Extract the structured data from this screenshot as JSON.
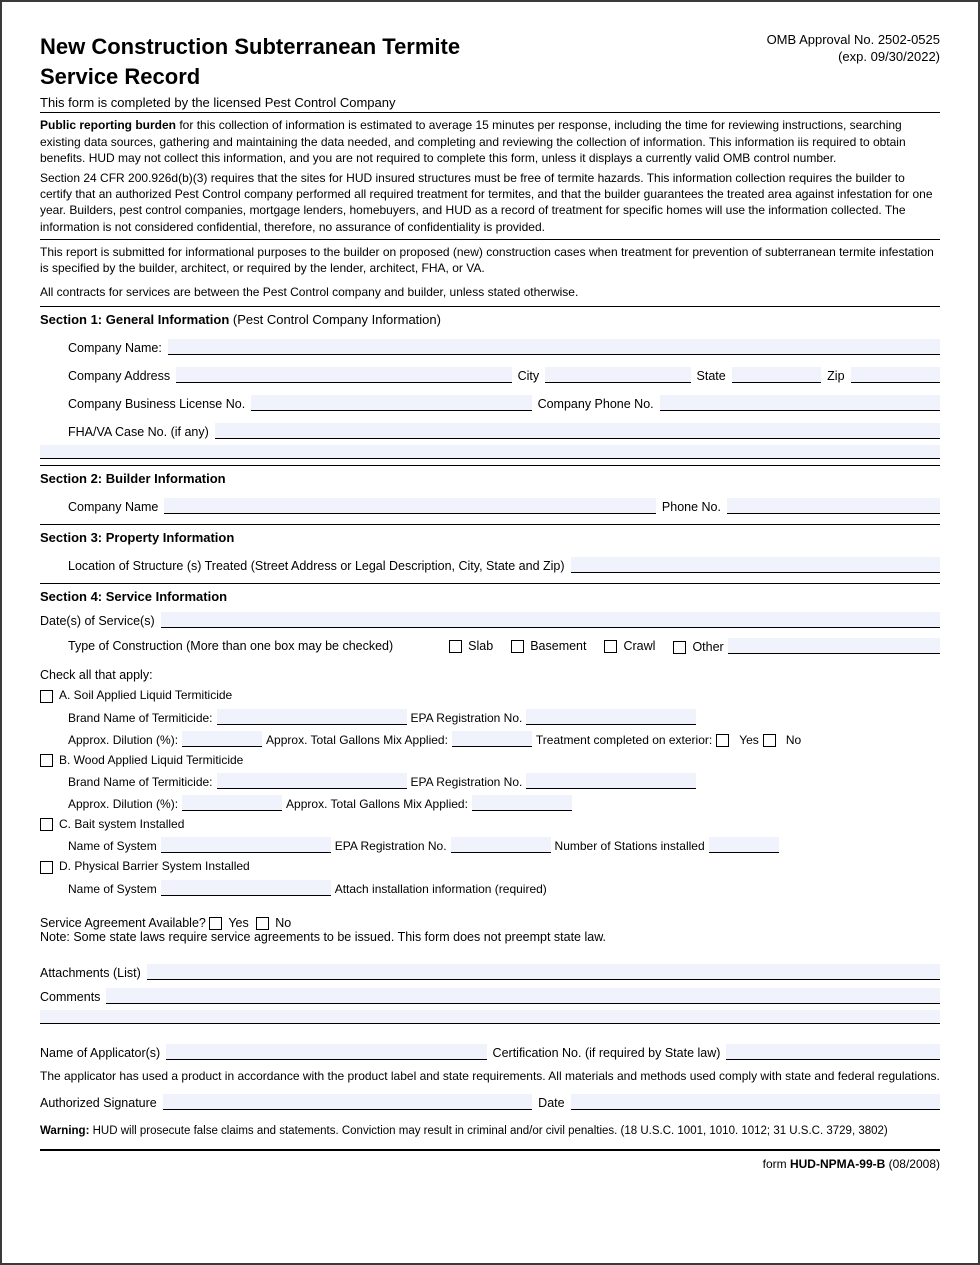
{
  "header": {
    "title_line1": "New Construction Subterranean Termite",
    "title_line2": "Service Record",
    "omb_line1": "OMB Approval No. 2502-0525",
    "omb_line2": "(exp. 09/30/2022)",
    "subtitle": "This form is completed by the licensed Pest Control Company"
  },
  "intro": {
    "burden_label": "Public reporting burden",
    "burden_text": " for this collection of information is estimated to average 15 minutes per response, including the time for reviewing instructions, searching existing data sources, gathering and maintaining the data needed, and completing and reviewing the collection of information. This information iis required to obtain benefits. HUD may not collect this information, and you are not required to complete this form, unless it displays a currently valid OMB control number.",
    "cfr": "Section 24 CFR 200.926d(b)(3) requires that the sites for HUD insured structures must be free of termite hazards. This information collection requires the builder to certify that an authorized Pest Control company performed all required treatment for termites, and that the builder guarantees the treated area against infestation for one year. Builders, pest control companies, mortgage lenders, homebuyers, and HUD as a record of treatment for specific homes will use the information collected. The information is not considered confidential, therefore, no assurance of confidentiality is provided.",
    "purpose": "This report is submitted for informational purposes to the builder on proposed (new) construction cases when treatment for prevention of subterranean termite infestation is specified by the builder, architect, or required by the lender, architect, FHA, or VA.",
    "contracts": "All contracts for services are between the Pest Control company and builder, unless stated otherwise."
  },
  "s1": {
    "head": "Section 1: General Information",
    "head_paren": " (Pest Control Company Information)",
    "company_name": "Company Name:",
    "company_address": "Company Address",
    "city": "City",
    "state": "State",
    "zip": "Zip",
    "license": "Company Business License No.",
    "phone": "Company Phone No.",
    "fhava": "FHA/VA Case No. (if any)"
  },
  "s2": {
    "head": "Section 2: Builder Information",
    "company_name": "Company Name",
    "phone": "Phone No."
  },
  "s3": {
    "head": "Section 3: Property Information",
    "location": "Location of Structure (s) Treated (Street Address or Legal Description, City, State and Zip)"
  },
  "s4": {
    "head": "Section 4: Service Information",
    "dates": "Date(s) of Service(s)",
    "type_label": "Type of Construction (More than one box may be checked)",
    "slab": "Slab",
    "basement": "Basement",
    "crawl": "Crawl",
    "other": "Other",
    "check_all": "Check all that apply:",
    "a": "A. Soil Applied Liquid Termiticide",
    "b": "B. Wood Applied Liquid Termiticide",
    "c": "C. Bait system Installed",
    "d": "D. Physical Barrier System Installed",
    "brand": "Brand Name of Termiticide:",
    "epa": "EPA Registration No.",
    "dilution": "Approx. Dilution (%):",
    "gallons": "Approx. Total Gallons Mix Applied:",
    "exterior": "Treatment completed on exterior:",
    "yes": "Yes",
    "no": "No",
    "system_name": "Name of System",
    "stations": "Number of Stations installed",
    "attach_info": "Attach installation information (required)",
    "svc_agreement": "Service Agreement Available?",
    "svc_note": "Note: Some state laws require service agreements to be issued. This form does not preempt state law.",
    "attachments": "Attachments (List)",
    "comments": "Comments",
    "applicator": "Name of Applicator(s)",
    "cert": "Certification No. (if required by State law)",
    "compliance": "The applicator has used a product in accordance with the product label and state requirements. All materials and methods used comply with state and federal regulations.",
    "signature": "Authorized Signature",
    "date": "Date",
    "warning_label": "Warning:",
    "warning": " HUD will prosecute false claims and statements. Conviction may result in criminal and/or civil penalties. (18 U.S.C. 1001, 1010. 1012; 31 U.S.C. 3729, 3802)"
  },
  "footer": {
    "form_prefix": "form ",
    "form_no": "HUD-NPMA-99-B",
    "form_date": " (08/2008)"
  }
}
